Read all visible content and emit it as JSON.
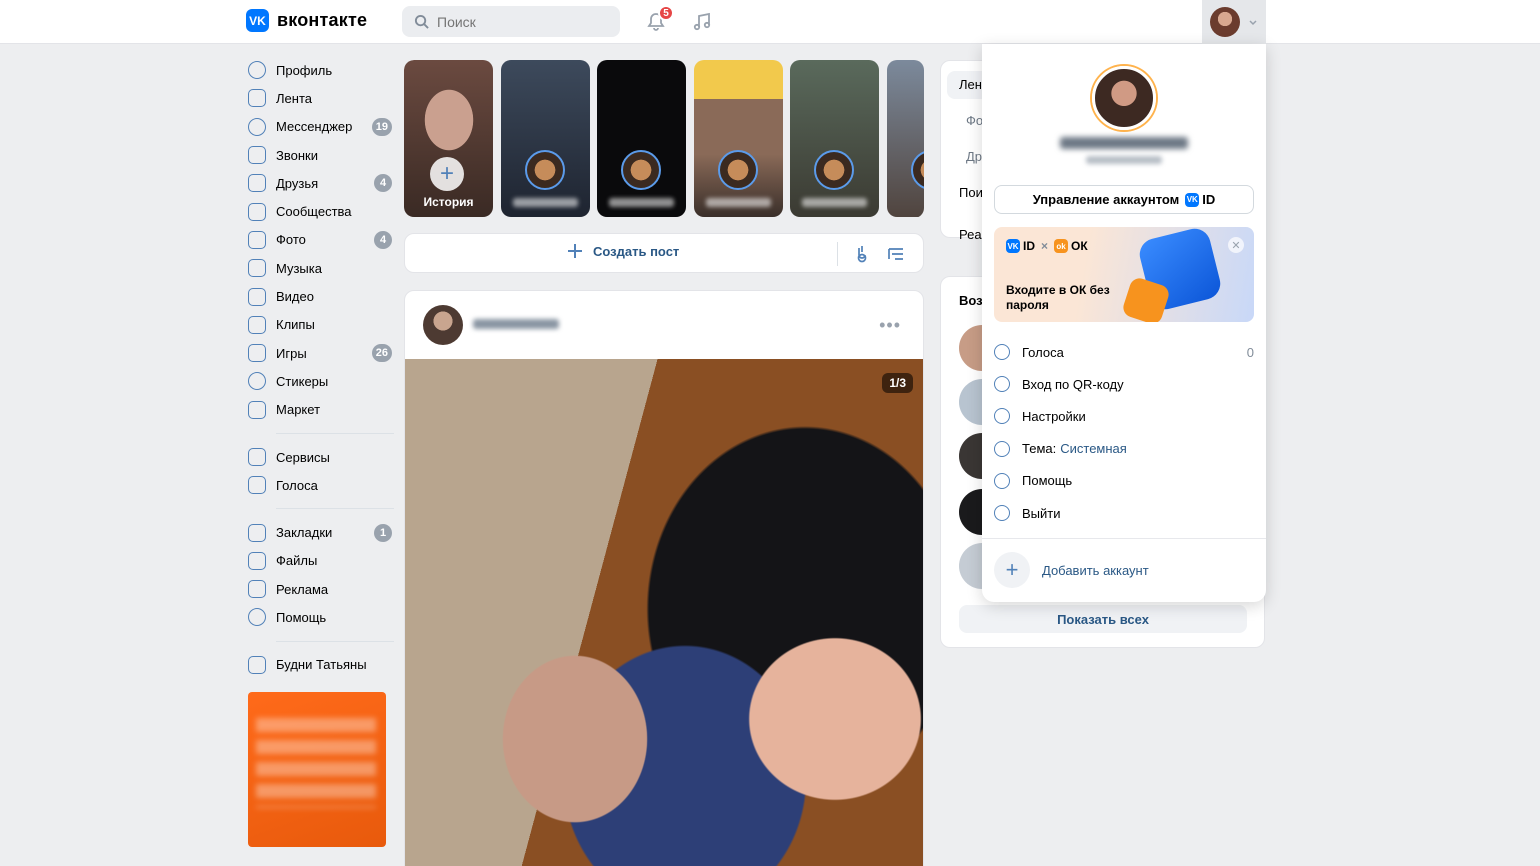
{
  "header": {
    "logo_mark": "VK",
    "logo_text": "вконтакте",
    "search_placeholder": "Поиск",
    "notifications_count": "5"
  },
  "sidebar": {
    "items": [
      {
        "label": "Профиль",
        "icon": "user-circle-icon",
        "count": ""
      },
      {
        "label": "Лента",
        "icon": "feed-icon",
        "count": ""
      },
      {
        "label": "Мессенджер",
        "icon": "message-icon",
        "count": "19"
      },
      {
        "label": "Звонки",
        "icon": "phone-icon",
        "count": ""
      },
      {
        "label": "Друзья",
        "icon": "friends-icon",
        "count": "4"
      },
      {
        "label": "Сообщества",
        "icon": "communities-icon",
        "count": ""
      },
      {
        "label": "Фото",
        "icon": "photo-icon",
        "count": "4"
      },
      {
        "label": "Музыка",
        "icon": "music-icon",
        "count": ""
      },
      {
        "label": "Видео",
        "icon": "video-icon",
        "count": ""
      },
      {
        "label": "Клипы",
        "icon": "clips-icon",
        "count": ""
      },
      {
        "label": "Игры",
        "icon": "gamepad-icon",
        "count": "26"
      },
      {
        "label": "Стикеры",
        "icon": "sticker-icon",
        "count": ""
      },
      {
        "label": "Маркет",
        "icon": "market-icon",
        "count": ""
      }
    ],
    "items2": [
      {
        "label": "Сервисы",
        "icon": "services-icon",
        "count": ""
      },
      {
        "label": "Голоса",
        "icon": "votes-icon",
        "count": ""
      }
    ],
    "items3": [
      {
        "label": "Закладки",
        "icon": "bookmark-icon",
        "count": "1"
      },
      {
        "label": "Файлы",
        "icon": "file-icon",
        "count": ""
      },
      {
        "label": "Реклама",
        "icon": "megaphone-icon",
        "count": ""
      },
      {
        "label": "Помощь",
        "icon": "help-icon",
        "count": ""
      }
    ],
    "items4": [
      {
        "label": "Будни Татьяны",
        "icon": "community-icon",
        "count": ""
      }
    ]
  },
  "stories": {
    "create_label": "История"
  },
  "compose": {
    "create_post_label": "Создать пост"
  },
  "post": {
    "photo_counter": "1/3"
  },
  "right": {
    "tabs": [
      "Лент",
      "Фо",
      "Др",
      "Пои",
      "Реа"
    ],
    "friends_title": "Воз",
    "show_all_label": "Показать всех"
  },
  "dropdown": {
    "manage_label": "Управление аккаунтом",
    "id_label": "ID",
    "banner_ok_label": "ОК",
    "banner_cross": "×",
    "banner_text": "Входите в ОК без пароля",
    "menu": [
      {
        "label": "Голоса",
        "icon": "votes-icon",
        "value": "0"
      },
      {
        "label": "Вход по QR-коду",
        "icon": "qr-icon",
        "value": ""
      },
      {
        "label": "Настройки",
        "icon": "gear-icon",
        "value": ""
      },
      {
        "label": "Тема:",
        "icon": "palette-icon",
        "value": "",
        "accent": "Системная"
      },
      {
        "label": "Помощь",
        "icon": "help-icon",
        "value": ""
      },
      {
        "label": "Выйти",
        "icon": "logout-icon",
        "value": ""
      }
    ],
    "add_account_label": "Добавить аккаунт"
  },
  "colors": {
    "accent": "#0077ff",
    "link": "#2a5885",
    "badge_red": "#e64646",
    "background": "#edeef0"
  }
}
